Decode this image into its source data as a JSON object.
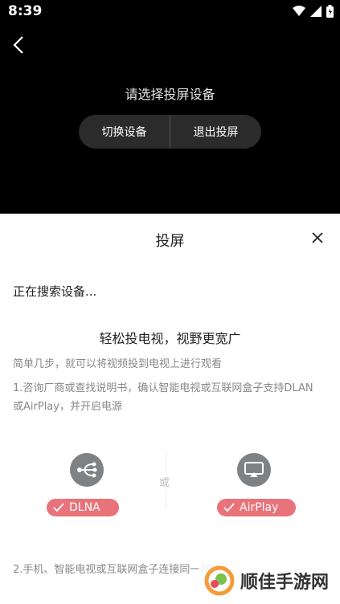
{
  "status_bar": {
    "time": "8:39"
  },
  "top": {
    "prompt": "请选择投屏设备",
    "switch_label": "切换设备",
    "exit_label": "退出投屏"
  },
  "sheet": {
    "title": "投屏",
    "searching": "正在搜索设备...",
    "headline": "轻松投电视，视野更宽广",
    "sub": "简单几步，就可以将视频投到电视上进行观看",
    "step1": "1.咨询厂商或查找说明书，确认智能电视或互联网盒子支持DLAN或AirPlay，并开启电源",
    "or_text": "或",
    "dlna_label": "DLNA",
    "airplay_label": "AirPlay",
    "step2": "2.手机、智能电视或互联网盒子连接同一网络"
  },
  "watermark": {
    "text": "顺佳手游网"
  },
  "colors": {
    "accent": "#e8737a",
    "icon_gray": "#7f8285",
    "pill_bg": "#2b2b2b"
  }
}
